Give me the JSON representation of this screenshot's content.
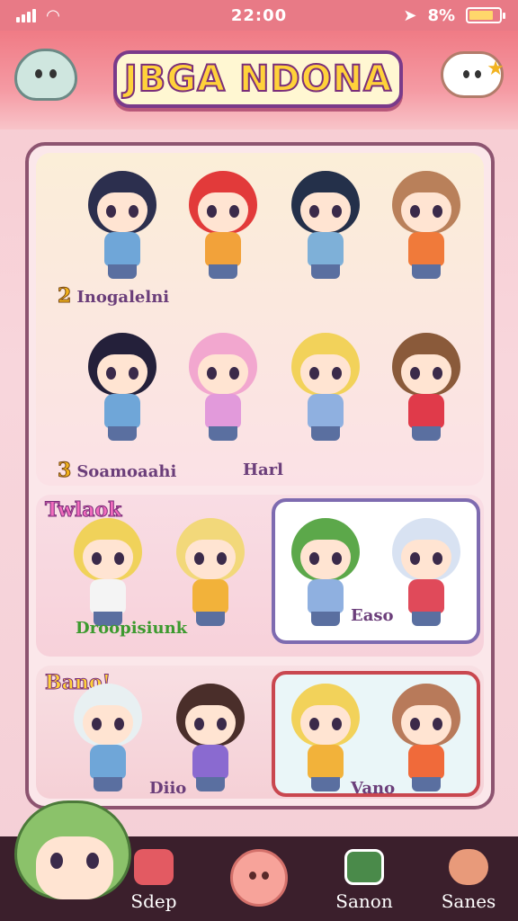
{
  "status_bar": {
    "time": "22:00",
    "battery": "8%",
    "battery_level": 0.8
  },
  "header": {
    "title": "JBGA NDONA",
    "left_icon": "ghost-icon",
    "right_icon": "chat-bubble-icon"
  },
  "roster": {
    "row1_label_num": "2",
    "row1_label": "Inogalelni",
    "row2_label_num": "3",
    "row2_label": "Soamoaahi",
    "row2_extra": "Harl",
    "section2_tag": "Twlaok",
    "section2_label": "Droopisiunk",
    "section2_box_label": "Easo",
    "section3_tag": "Bano!",
    "section3_label": "Diio",
    "section3_box_label": "Vano"
  },
  "characters": [
    {
      "hair": "#2c2f4e",
      "body": "#6fa6d8"
    },
    {
      "hair": "#e23a3a",
      "body": "#f2a23a"
    },
    {
      "hair": "#24304a",
      "body": "#7eb0d8"
    },
    {
      "hair": "#b9805a",
      "body": "#f07a3a"
    },
    {
      "hair": "#24203a",
      "body": "#6fa6d8"
    },
    {
      "hair": "#f2a7cf",
      "body": "#e29adb"
    },
    {
      "hair": "#f2d25a",
      "body": "#8fb0e0"
    },
    {
      "hair": "#8a5a3a",
      "body": "#e03a4a"
    },
    {
      "hair": "#f0d25a",
      "body": "#f4f4f4"
    },
    {
      "hair": "#f2d87a",
      "body": "#f2b23a"
    },
    {
      "hair": "#5ca84a",
      "body": "#8fb0e0"
    },
    {
      "hair": "#d8e2f2",
      "body": "#e04a5a"
    },
    {
      "hair": "#e8f0f2",
      "body": "#6fa6d8"
    },
    {
      "hair": "#4a2e2a",
      "body": "#8a6ad0"
    },
    {
      "hair": "#f2d25a",
      "body": "#f2b23a"
    },
    {
      "hair": "#b87a5a",
      "body": "#f06a3a"
    }
  ],
  "bottom_nav": {
    "item1": "Sdep",
    "item2": "Sanon",
    "item3": "Sanes"
  }
}
